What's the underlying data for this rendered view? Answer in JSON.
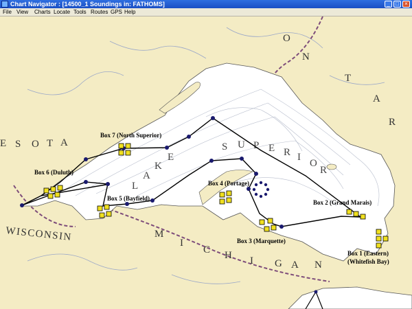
{
  "window": {
    "title": "Chart Navigator : [14500_1 Soundings in: FATHOMS]"
  },
  "menu": [
    "File",
    "View",
    "Charts",
    "Locate",
    "Tools",
    "Routes",
    "GPS",
    "Help"
  ],
  "map": {
    "lake_name": [
      "L",
      "A",
      "K",
      "E",
      "S",
      "U",
      "P",
      "E",
      "R",
      "I",
      "O",
      "R"
    ],
    "regions": {
      "ontario": [
        "O",
        "N",
        "T",
        "A",
        "R"
      ],
      "minnesota": [
        "E",
        "S",
        "O",
        "T",
        "A"
      ],
      "wisconsin": "WISCONSIN",
      "michigan": [
        "M",
        "I",
        "C",
        "H",
        "I",
        "G",
        "A",
        "N"
      ]
    },
    "boxes": [
      {
        "id": 7,
        "label": "Box 7 (North Superior)"
      },
      {
        "id": 6,
        "label": "Box 6 (Duluth)"
      },
      {
        "id": 5,
        "label": "Box 5 (Bayfield)"
      },
      {
        "id": 4,
        "label": "Box 4 (Portage)"
      },
      {
        "id": 2,
        "label": "Box 2 (Grand Marais)"
      },
      {
        "id": 3,
        "label": "Box 3 (Marquette)"
      },
      {
        "id": 1,
        "label": "Box 1 (Eastern)",
        "sublabel": "(Whitefish Bay)"
      }
    ],
    "colors": {
      "land": "#f4ecc4",
      "water": "#ffffff",
      "route": "#000000",
      "waypoint": "#1a1a6e",
      "box_marker": "#f0e020",
      "border": "#7d4c7a"
    }
  }
}
